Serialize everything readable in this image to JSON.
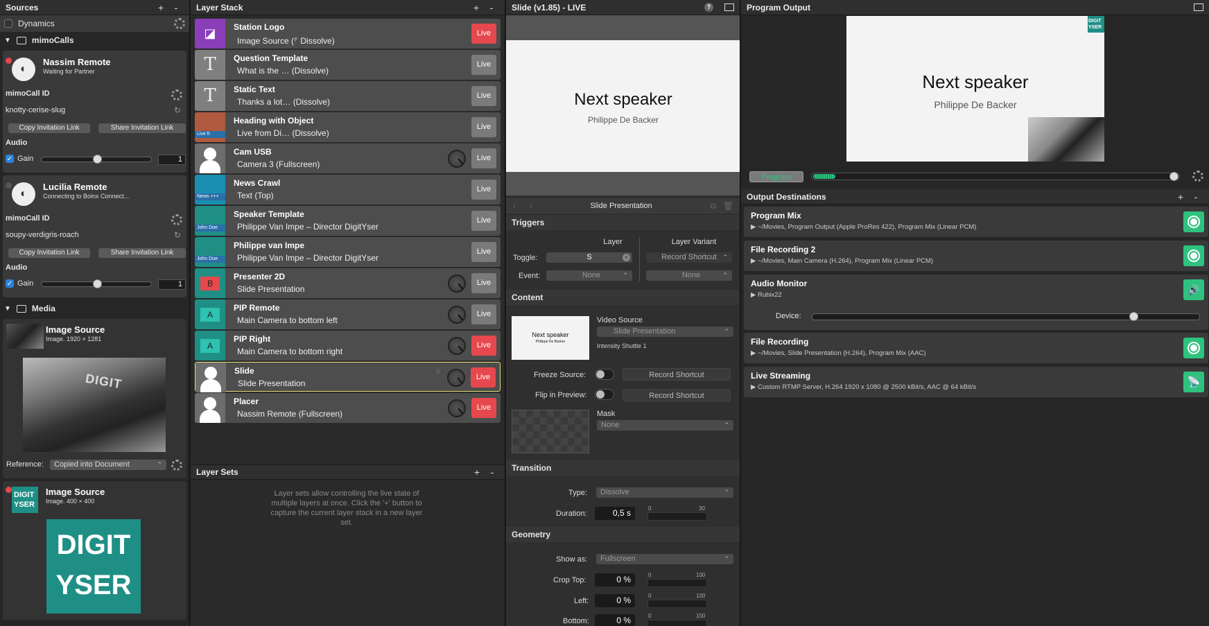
{
  "sources": {
    "title": "Sources",
    "add": "+",
    "remove": "-",
    "dynamics_label": "Dynamics",
    "group_calls": "mimoCalls",
    "call1": {
      "name": "Nassim Remote",
      "status": "Waiting for Partner",
      "id_label": "mimoCall ID",
      "id_value": "knotty-cerise-slug",
      "copy_btn": "Copy Invitation Link",
      "share_btn": "Share Invitation Link",
      "audio_label": "Audio",
      "gain_label": "Gain",
      "gain_value": "1"
    },
    "call2": {
      "name": "Lucilia Remote",
      "status": "Connecting to Boinx Connect...",
      "id_label": "mimoCall ID",
      "id_value": "soupy-verdigris-roach",
      "copy_btn": "Copy Invitation Link",
      "share_btn": "Share Invitation Link",
      "audio_label": "Audio",
      "gain_label": "Gain",
      "gain_value": "1"
    },
    "group_media": "Media",
    "media1": {
      "name": "Image Source",
      "info": "Image. 1920 × 1281",
      "ref_label": "Reference:",
      "ref_value": "Copied into Document"
    },
    "media2": {
      "name": "Image Source",
      "info": "Image. 400 × 400",
      "logo_top": "DIGIT",
      "logo_bottom": "YSER"
    }
  },
  "layers": {
    "title": "Layer Stack",
    "add": "+",
    "remove": "-",
    "items": [
      {
        "name": "Station Logo",
        "sub": "Image Source (⸁ Dissolve)",
        "live": "Live",
        "on": true,
        "dial": false
      },
      {
        "name": "Question Template",
        "sub": "What is the … (Dissolve)",
        "live": "Live",
        "on": false,
        "dial": false
      },
      {
        "name": "Static Text",
        "sub": "Thanks a lot… (Dissolve)",
        "live": "Live",
        "on": false,
        "dial": false
      },
      {
        "name": "Heading with Object",
        "sub": "Live from Di… (Dissolve)",
        "live": "Live",
        "on": false,
        "dial": false
      },
      {
        "name": "Cam USB",
        "sub": "Camera 3 (Fullscreen)",
        "live": "Live",
        "on": false,
        "dial": true
      },
      {
        "name": "News Crawl",
        "sub": "Text (Top)",
        "live": "Live",
        "on": false,
        "dial": false
      },
      {
        "name": "Speaker Template",
        "sub": "Philippe Van Impe – Director DigitYser",
        "live": "Live",
        "on": false,
        "dial": false
      },
      {
        "name": "Philippe van Impe",
        "sub": "Philippe Van Impe – Director DigitYser",
        "live": "Live",
        "on": false,
        "dial": false
      },
      {
        "name": "Presenter 2D",
        "sub": "Slide Presentation",
        "live": "Live",
        "on": false,
        "dial": true
      },
      {
        "name": "PIP Remote",
        "sub": "Main Camera to bottom left",
        "live": "Live",
        "on": false,
        "dial": true
      },
      {
        "name": "PIP Right",
        "sub": "Main Camera to bottom right",
        "live": "Live",
        "on": true,
        "dial": true
      },
      {
        "name": "Slide",
        "sub": "Slide Presentation",
        "live": "Live",
        "on": true,
        "dial": true
      },
      {
        "name": "Placer",
        "sub": "Nassim Remote (Fullscreen)",
        "live": "Live",
        "on": true,
        "dial": true
      }
    ],
    "thumb_labels": {
      "news": "News +++",
      "john": "John Doe",
      "livefr": "Live fr",
      "b": "B",
      "a": "A",
      "s": "S"
    },
    "sets_title": "Layer Sets",
    "sets_hint": "Layer sets allow controlling the live state of multiple layers at once. Click the '+' button to capture the current layer stack in a new layer set."
  },
  "slide": {
    "title": "Slide (v1.85) - LIVE",
    "help": "?",
    "preview_title": "Next speaker",
    "preview_sub": "Philippe De Backer",
    "source_name": "Slide Presentation",
    "triggers": "Triggers",
    "layer_col": "Layer",
    "variant_col": "Layer Variant",
    "toggle_label": "Toggle:",
    "toggle_value": "S",
    "record_shortcut": "Record Shortcut",
    "event_label": "Event:",
    "none": "None",
    "content": "Content",
    "video_source_label": "Video Source",
    "video_source_value": "Slide Presentation",
    "intensity": "Intensity Shuttle 1",
    "freeze_label": "Freeze Source:",
    "flip_label": "Flip in Preview:",
    "mask_label": "Mask",
    "mask_value": "None",
    "transition": "Transition",
    "type_label": "Type:",
    "type_value": "Dissolve",
    "duration_label": "Duration:",
    "duration_value": "0,5 s",
    "dur_min": "0",
    "dur_max": "30",
    "geometry": "Geometry",
    "showas_label": "Show as:",
    "showas_value": "Fullscreen",
    "crop_top_label": "Crop Top:",
    "left_label": "Left:",
    "bottom_label": "Bottom:",
    "zero_pct": "0 %",
    "min0": "0",
    "max100": "100"
  },
  "program": {
    "title": "Program Output",
    "preview_title": "Next speaker",
    "preview_sub": "Philippe De Backer",
    "logo_top": "DIGIT",
    "logo_bottom": "YSER",
    "program_btn": "Program",
    "dest_title": "Output Destinations",
    "add": "+",
    "remove": "-",
    "dests": [
      {
        "name": "Program Mix",
        "desc": "~/Movies, Program Output (Apple ProRes 422), Program Mix (Linear PCM)"
      },
      {
        "name": "File Recording 2",
        "desc": "~/Movies, Main Camera (H.264), Program Mix (Linear PCM)"
      },
      {
        "name": "Audio Monitor",
        "desc": "Rubix22",
        "device_label": "Device:"
      },
      {
        "name": "File Recording",
        "desc": "~/Movies, Slide Presentation (H.264), Program Mix (AAC)"
      },
      {
        "name": "Live Streaming",
        "desc": "Custom RTMP Server, H.264 1920 x 1080 @ 2500 kBit/s, AAC @ 64 kBit/s"
      }
    ]
  }
}
